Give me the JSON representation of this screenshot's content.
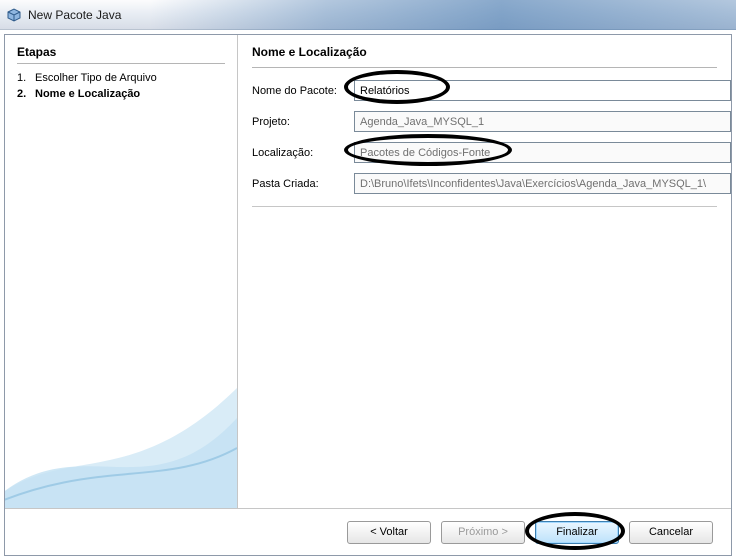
{
  "window": {
    "title": "New Pacote Java"
  },
  "sidebar": {
    "heading": "Etapas",
    "steps": [
      {
        "num": "1.",
        "label": "Escolher Tipo de Arquivo"
      },
      {
        "num": "2.",
        "label": "Nome e Localização"
      }
    ]
  },
  "panel": {
    "heading": "Nome e Localização",
    "labels": {
      "packageName": "Nome do Pacote:",
      "project": "Projeto:",
      "location": "Localização:",
      "createdFolder": "Pasta Criada:"
    },
    "values": {
      "packageName": "Relatórios",
      "project": "Agenda_Java_MYSQL_1",
      "location": "Pacotes de Códigos-Fonte",
      "createdFolder": "D:\\Bruno\\Ifets\\Inconfidentes\\Java\\Exercícios\\Agenda_Java_MYSQL_1\\"
    }
  },
  "buttons": {
    "back": "< Voltar",
    "next": "Próximo >",
    "finish": "Finalizar",
    "cancel": "Cancelar"
  }
}
